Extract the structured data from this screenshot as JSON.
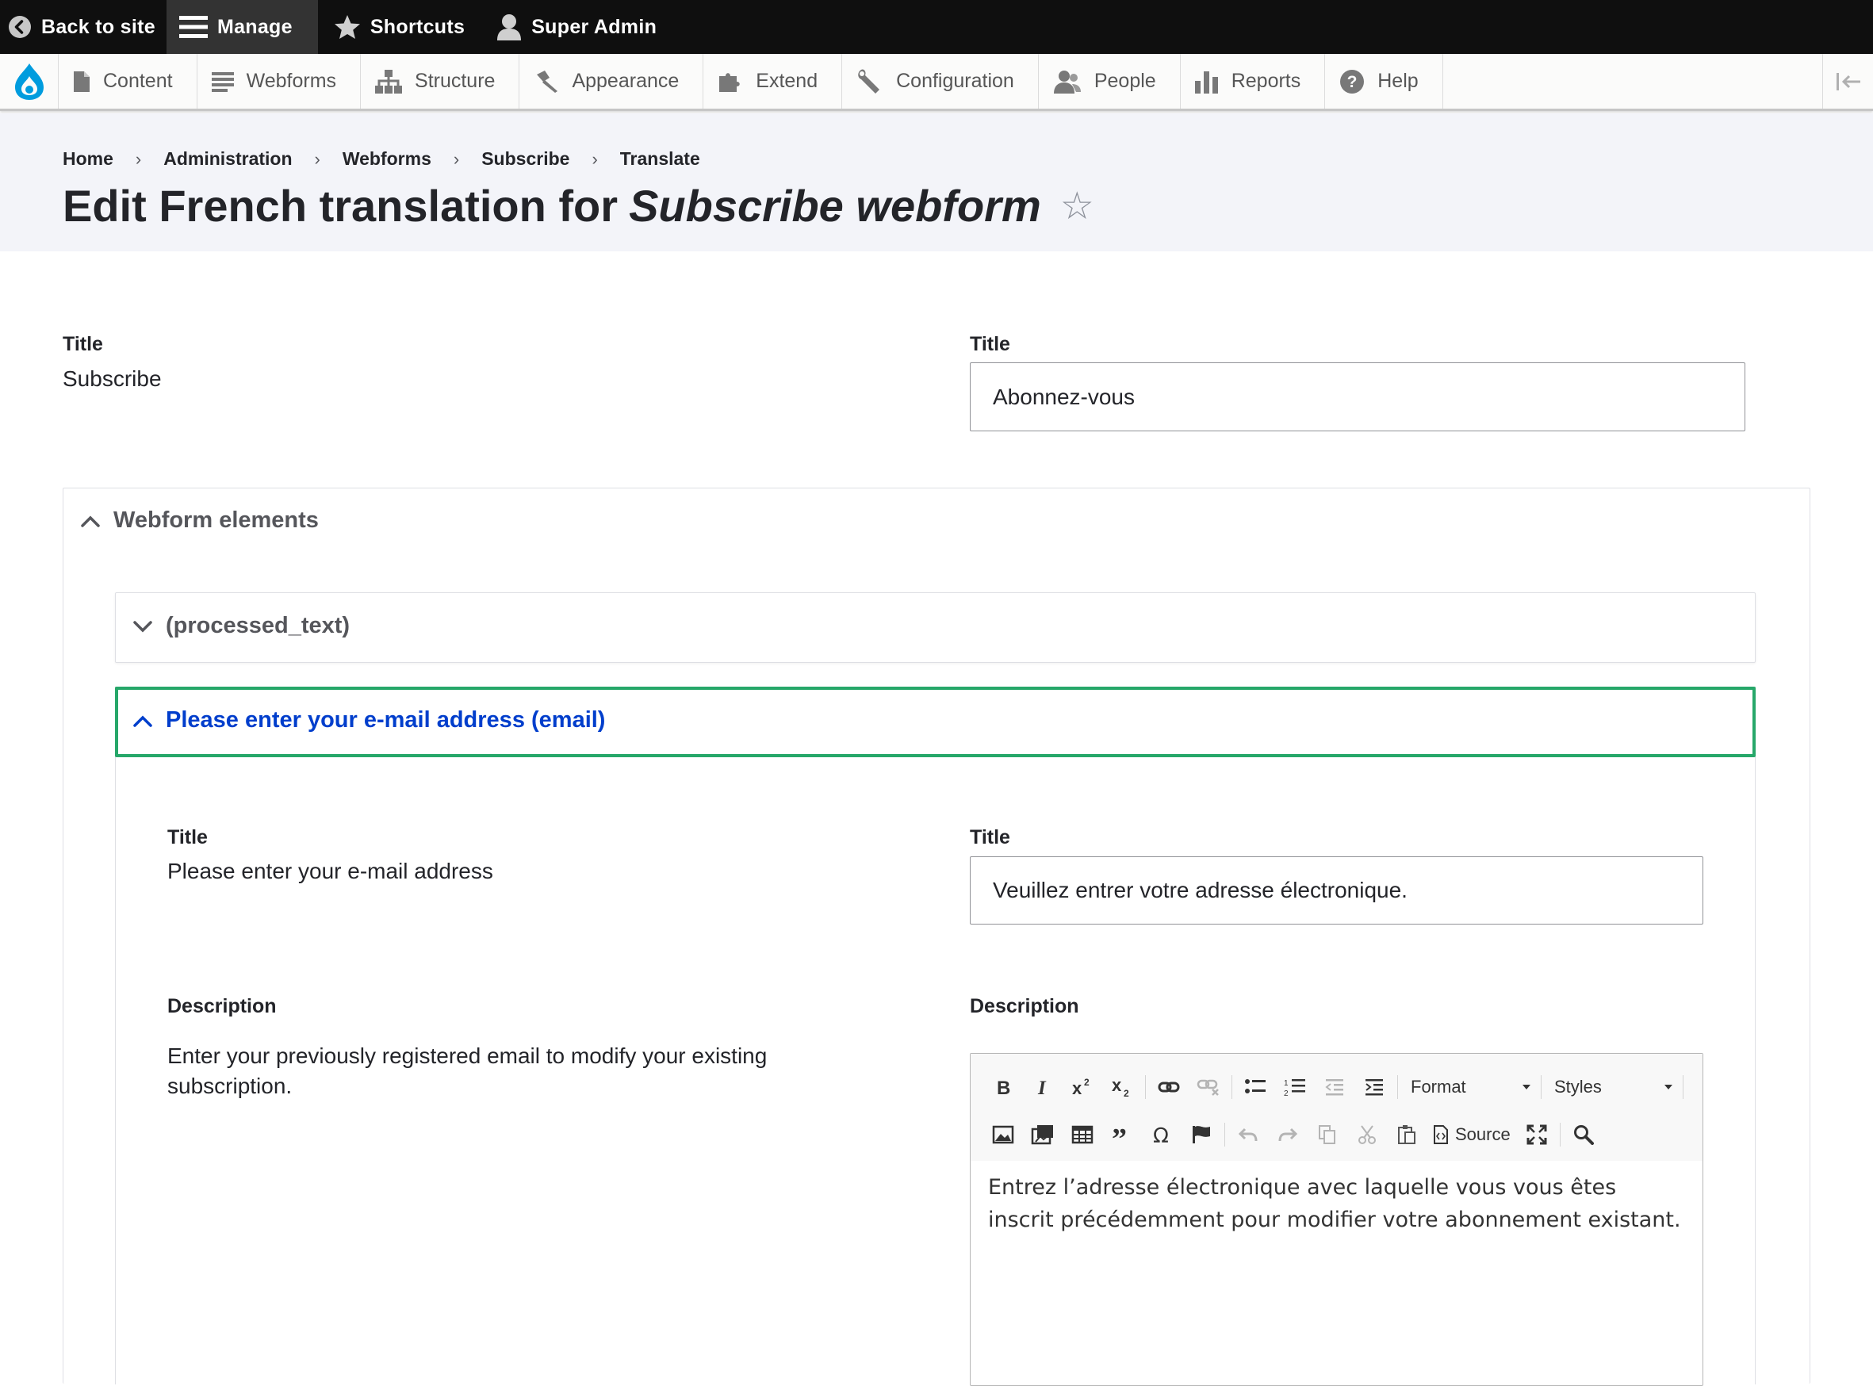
{
  "toolbar": {
    "back_to_site": "Back to site",
    "manage": "Manage",
    "shortcuts": "Shortcuts",
    "user": "Super Admin"
  },
  "admin_menu": {
    "items": [
      {
        "label": "Content",
        "icon": "document-icon"
      },
      {
        "label": "Webforms",
        "icon": "list-icon"
      },
      {
        "label": "Structure",
        "icon": "sitemap-icon"
      },
      {
        "label": "Appearance",
        "icon": "brush-icon"
      },
      {
        "label": "Extend",
        "icon": "puzzle-icon"
      },
      {
        "label": "Configuration",
        "icon": "wrench-icon"
      },
      {
        "label": "People",
        "icon": "people-icon"
      },
      {
        "label": "Reports",
        "icon": "bar-chart-icon"
      },
      {
        "label": "Help",
        "icon": "help-icon"
      }
    ]
  },
  "breadcrumb": [
    "Home",
    "Administration",
    "Webforms",
    "Subscribe",
    "Translate"
  ],
  "breadcrumb_separator": "›",
  "page": {
    "title_prefix": "Edit French translation for",
    "title_emphasis": "Subscribe webform",
    "star": "☆"
  },
  "title_field": {
    "source_label": "Title",
    "source_value": "Subscribe",
    "target_label": "Title",
    "target_value": "Abonnez-vous"
  },
  "webform_elements": {
    "summary": "Webform elements",
    "processed_text": "(processed_text)",
    "email": {
      "summary": "Please enter your e-mail address (email)",
      "title_source_label": "Title",
      "title_source_value": "Please enter your e-mail address",
      "title_target_label": "Title",
      "title_target_value": "Veuillez entrer votre adresse électronique.",
      "desc_source_label": "Description",
      "desc_source_value": "Enter your previously registered email to modify your existing subscription.",
      "desc_target_label": "Description",
      "editor": {
        "format_label": "Format",
        "styles_label": "Styles",
        "source_label": "Source",
        "body": "Entrez l’adresse électronique avec laquelle vous vous êtes inscrit précédemment pour modifier votre abonnement existant."
      }
    }
  },
  "colors": {
    "toolbar_bg": "#0f0f0f",
    "header_bg": "#f3f4f9",
    "focus_border": "#26a769",
    "link_blue": "#003ecc",
    "drupal_blue": "#009cde"
  }
}
